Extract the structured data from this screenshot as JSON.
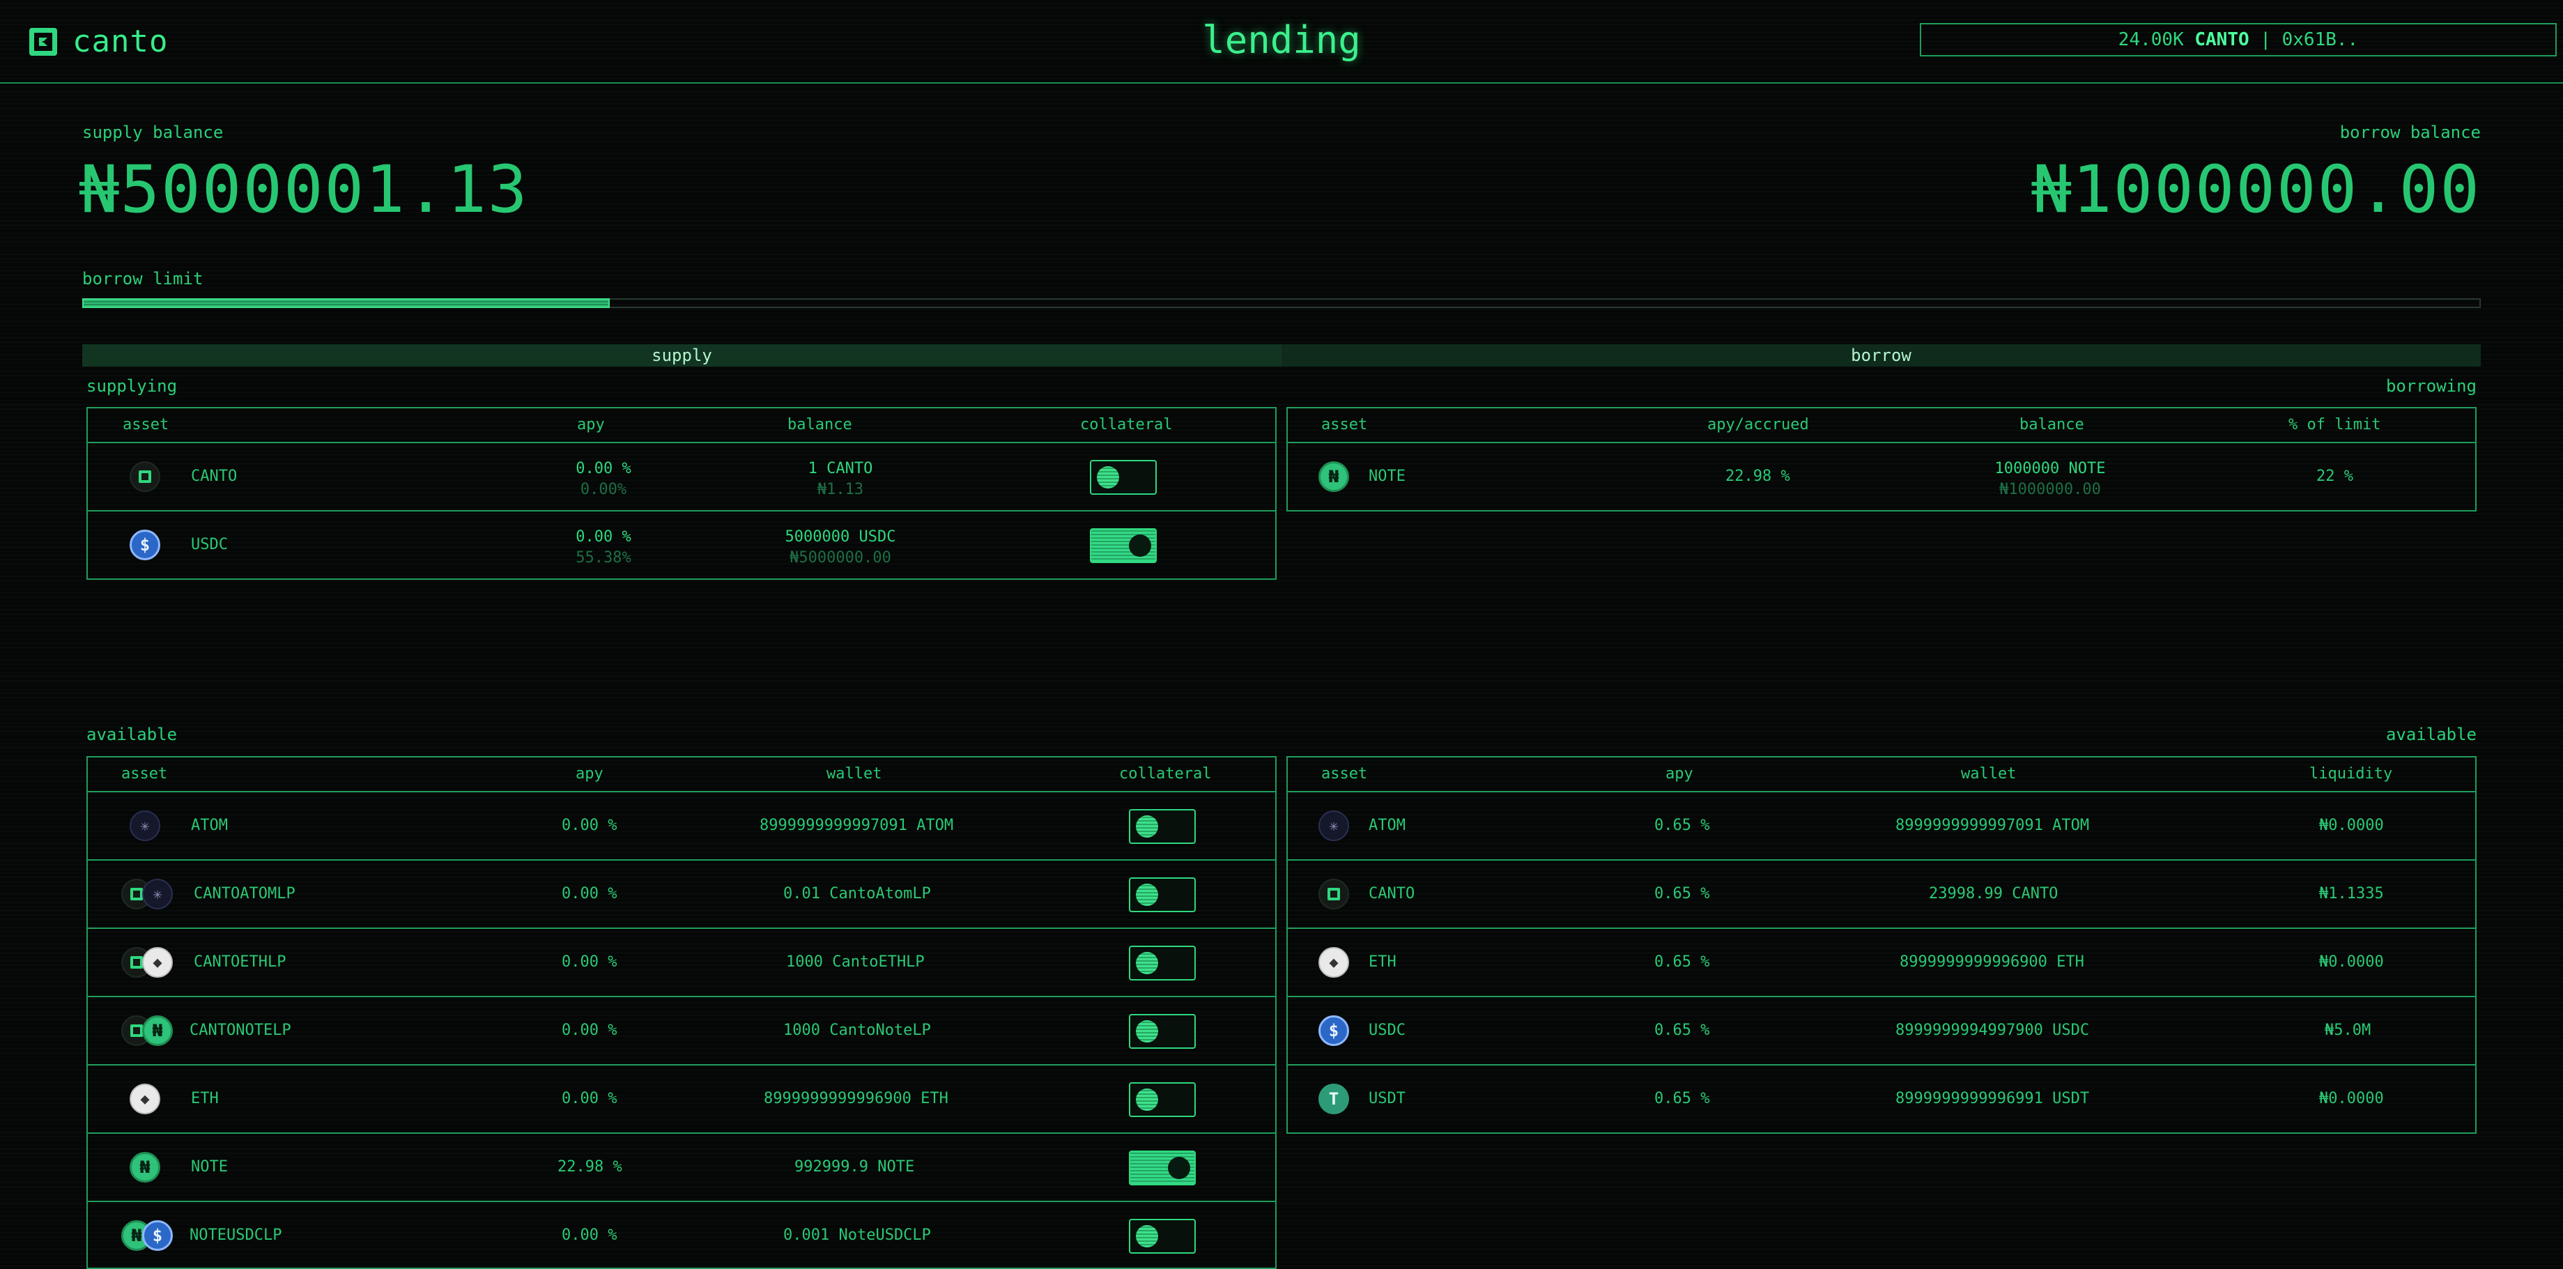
{
  "app": {
    "name": "canto",
    "page_title": "lending"
  },
  "wallet_chip": {
    "amount": "24.00K",
    "token": "CANTO",
    "address": "| 0x61B.."
  },
  "balances": {
    "supply_label": "supply balance",
    "supply_value": "₦5000001.13",
    "borrow_label": "borrow balance",
    "borrow_value": "₦1000000.00",
    "limit_label": "borrow limit",
    "limit_fraction": 0.22
  },
  "tabs": [
    {
      "label": "supply"
    },
    {
      "label": "borrow"
    }
  ],
  "supplying": {
    "section_label": "supplying",
    "columns": [
      "asset",
      "apy",
      "balance",
      "collateral"
    ],
    "rows": [
      {
        "icon": "canto-icon",
        "asset": "CANTO",
        "apy": "0.00 %",
        "apy_sub": "0.00%",
        "balance": "1 CANTO",
        "balance_sub": "₦1.13",
        "collateral": false
      },
      {
        "icon": "usdc-icon",
        "asset": "USDC",
        "apy": "0.00 %",
        "apy_sub": "55.38%",
        "balance": "5000000 USDC",
        "balance_sub": "₦5000000.00",
        "collateral": true
      }
    ]
  },
  "borrowing": {
    "section_label": "borrowing",
    "columns": [
      "asset",
      "apy/accrued",
      "balance",
      "% of limit"
    ],
    "rows": [
      {
        "icon": "note-icon",
        "asset": "NOTE",
        "apy": "22.98 %",
        "balance": "1000000 NOTE",
        "balance_sub": "₦1000000.00",
        "limit": "22 %"
      }
    ]
  },
  "available_supply": {
    "section_label": "available",
    "columns": [
      "asset",
      "apy",
      "wallet",
      "collateral"
    ],
    "rows": [
      {
        "icon": "atom-icon",
        "asset": "ATOM",
        "apy": "0.00 %",
        "wallet": "8999999999997091 ATOM",
        "collateral": false
      },
      {
        "icon": "canto-atom-lp-icon",
        "asset": "CANTOATOMLP",
        "apy": "0.00 %",
        "wallet": "0.01 CantoAtomLP",
        "collateral": false
      },
      {
        "icon": "canto-eth-lp-icon",
        "asset": "CANTOETHLP",
        "apy": "0.00 %",
        "wallet": "1000 CantoETHLP",
        "collateral": false
      },
      {
        "icon": "canto-note-lp-icon",
        "asset": "CANTONOTELP",
        "apy": "0.00 %",
        "wallet": "1000 CantoNoteLP",
        "collateral": false
      },
      {
        "icon": "eth-icon",
        "asset": "ETH",
        "apy": "0.00 %",
        "wallet": "8999999999996900 ETH",
        "collateral": false
      },
      {
        "icon": "note-icon",
        "asset": "NOTE",
        "apy": "22.98 %",
        "wallet": "992999.9 NOTE",
        "collateral": true
      },
      {
        "icon": "note-usdc-lp-icon",
        "asset": "NOTEUSDCLP",
        "apy": "0.00 %",
        "wallet": "0.001 NoteUSDCLP",
        "collateral": false
      }
    ]
  },
  "available_borrow": {
    "section_label": "available",
    "columns": [
      "asset",
      "apy",
      "wallet",
      "liquidity"
    ],
    "rows": [
      {
        "icon": "atom-icon",
        "asset": "ATOM",
        "apy": "0.65 %",
        "wallet": "8999999999997091 ATOM",
        "liquidity": "₦0.0000"
      },
      {
        "icon": "canto-icon",
        "asset": "CANTO",
        "apy": "0.65 %",
        "wallet": "23998.99 CANTO",
        "liquidity": "₦1.1335"
      },
      {
        "icon": "eth-icon",
        "asset": "ETH",
        "apy": "0.65 %",
        "wallet": "8999999999996900 ETH",
        "liquidity": "₦0.0000"
      },
      {
        "icon": "usdc-icon",
        "asset": "USDC",
        "apy": "0.65 %",
        "wallet": "8999999994997900 USDC",
        "liquidity": "₦5.0M"
      },
      {
        "icon": "usdt-icon",
        "asset": "USDT",
        "apy": "0.65 %",
        "wallet": "8999999999996991 USDT",
        "liquidity": "₦0.0000"
      }
    ]
  },
  "colors": {
    "accent": "#2fd87f",
    "background": "#040705",
    "border": "#1f9d5d"
  }
}
